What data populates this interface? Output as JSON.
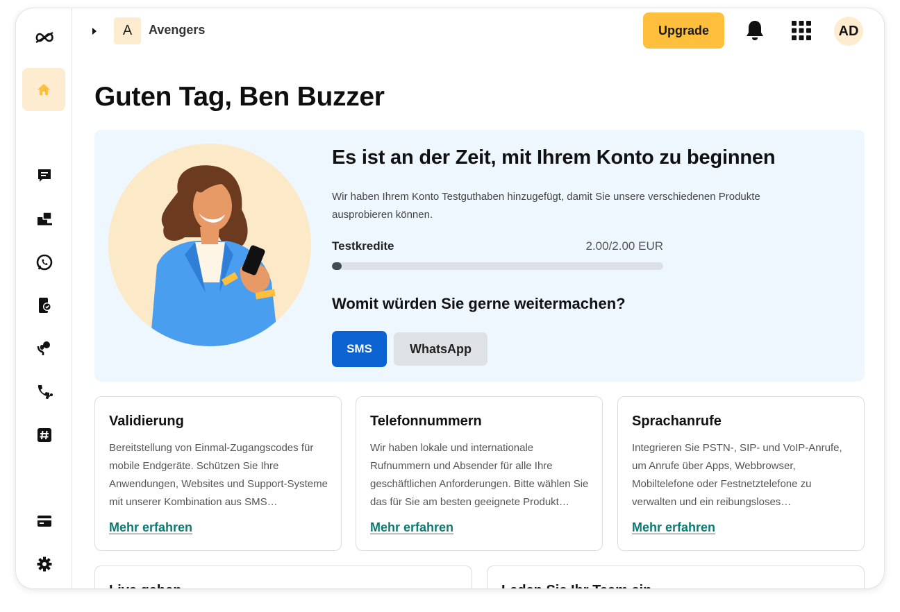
{
  "header": {
    "workspace_initial": "A",
    "workspace_name": "Avengers",
    "upgrade_label": "Upgrade",
    "avatar_initials": "AD"
  },
  "greeting": "Guten Tag, Ben Buzzer",
  "hero": {
    "title": "Es ist an der Zeit, mit Ihrem Konto zu beginnen",
    "text": "Wir haben Ihrem Konto Testguthaben hinzugefügt, damit Sie unsere verschiedenen Produkte ausprobieren können.",
    "credits_label": "Testkredite",
    "credits_value": "2.00/2.00 EUR",
    "credits_progress_fraction": 0.03,
    "question": "Womit würden Sie gerne weitermachen?",
    "buttons": {
      "sms": "SMS",
      "whatsapp": "WhatsApp"
    }
  },
  "cards": [
    {
      "title": "Validierung",
      "text": "Bereitstellung von Einmal-Zugangscodes für mobile Endgeräte. Schützen Sie Ihre Anwendungen, Websites und Support-Systeme mit unserer Kombination aus SMS…",
      "link": "Mehr erfahren"
    },
    {
      "title": "Telefonnummern",
      "text": "Wir haben lokale und internationale Rufnummern und Absender für alle Ihre geschäftlichen Anforderungen. Bitte wählen Sie das für Sie am besten geeignete Produkt…",
      "link": "Mehr erfahren"
    },
    {
      "title": "Sprachanrufe",
      "text": "Integrieren Sie PSTN-, SIP- und VoIP-Anrufe, um Anrufe über Apps, Webbrowser, Mobiltelefone oder Festnetztelefone zu verwalten und ein reibungsloses Spracherlebnis…",
      "link": "Mehr erfahren"
    }
  ],
  "cards_bottom": [
    {
      "title": "Live gehen"
    },
    {
      "title": "Laden Sie Ihr Team ein"
    }
  ],
  "sidebar_icons": [
    "logo-icon",
    "home-icon",
    "chat-icon",
    "inbox-icon",
    "whatsapp-icon",
    "verify-icon",
    "voice-icon",
    "phone-flow-icon",
    "hashtag-icon",
    "billing-card-icon",
    "settings-gear-icon"
  ],
  "colors": {
    "accent_yellow": "#fdbf3c",
    "home_highlight": "#fdeccf",
    "primary_blue": "#0b63d1",
    "link_teal": "#0c7b73",
    "hero_bg": "#eef6fe"
  }
}
